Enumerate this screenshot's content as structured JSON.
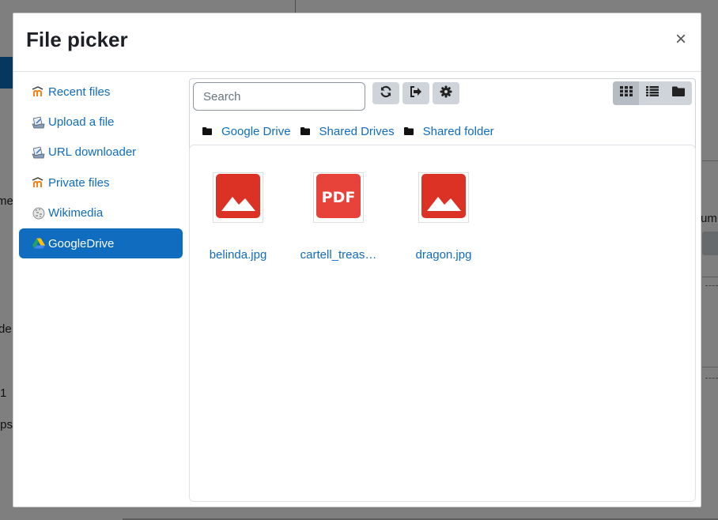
{
  "background": {
    "fragments": [
      "me",
      "de",
      "1",
      "ıps",
      "um"
    ]
  },
  "modal": {
    "title": "File picker",
    "close_symbol": "×"
  },
  "sidebar": {
    "items": [
      {
        "label": "Recent files",
        "icon": "moodle-icon"
      },
      {
        "label": "Upload a file",
        "icon": "upload-icon"
      },
      {
        "label": "URL downloader",
        "icon": "url-download-icon"
      },
      {
        "label": "Private files",
        "icon": "moodle-icon"
      },
      {
        "label": "Wikimedia",
        "icon": "wikimedia-icon"
      },
      {
        "label": "GoogleDrive",
        "icon": "google-drive-icon",
        "active": true
      }
    ]
  },
  "toolbar": {
    "search_placeholder": "Search",
    "buttons": [
      "refresh-icon",
      "logout-icon",
      "settings-icon"
    ],
    "views": [
      "grid-view-icon",
      "list-view-icon",
      "tree-view-icon"
    ],
    "active_view": "grid-view-icon"
  },
  "breadcrumb": [
    "Google Drive",
    "Shared Drives",
    "Shared folder"
  ],
  "files": [
    {
      "name": "belinda.jpg",
      "type": "image"
    },
    {
      "name": "cartell_treas…",
      "type": "pdf"
    },
    {
      "name": "dragon.jpg",
      "type": "image"
    }
  ],
  "colors": {
    "accent": "#0f6cbf",
    "image_thumb": "#dc3226",
    "pdf_thumb": "#e8433a"
  }
}
